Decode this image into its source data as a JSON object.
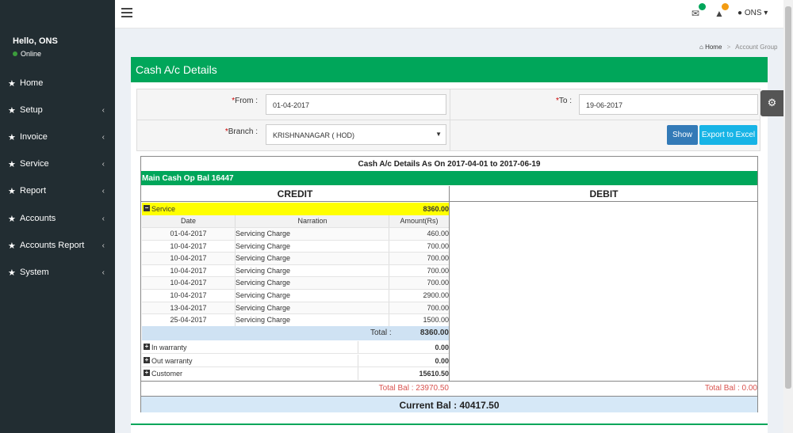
{
  "sidebar": {
    "greeting": "Hello, ONS",
    "status": "Online",
    "items": [
      {
        "label": "Home",
        "has_children": false
      },
      {
        "label": "Setup",
        "has_children": true
      },
      {
        "label": "Invoice",
        "has_children": true
      },
      {
        "label": "Service",
        "has_children": true
      },
      {
        "label": "Report",
        "has_children": true
      },
      {
        "label": "Accounts",
        "has_children": true
      },
      {
        "label": "Accounts Report",
        "has_children": true
      },
      {
        "label": "System",
        "has_children": true
      }
    ]
  },
  "topbar": {
    "user": "ONS",
    "icons": [
      "hamburger-icon",
      "mail-icon",
      "warning-icon",
      "user-icon"
    ],
    "badge_colors": [
      "#00a65a",
      "#f39c12"
    ]
  },
  "breadcrumb": {
    "home": "Home",
    "current": "Account Group"
  },
  "page": {
    "title": "Cash A/c Details"
  },
  "filters": {
    "from_label": "From :",
    "from_value": "01-04-2017",
    "to_label": "To :",
    "to_value": "19-06-2017",
    "branch_label": "Branch :",
    "branch_value": "KRISHNANAGAR ( HOD)",
    "show_label": "Show",
    "export_label": "Export to Excel"
  },
  "report": {
    "title": "Cash A/c Details As On 2017-04-01 to 2017-06-19",
    "opening_balance": "Main Cash Op Bal 16447",
    "credit_label": "CREDIT",
    "debit_label": "DEBIT",
    "service_group": {
      "name": "Service",
      "amount": "8360.00"
    },
    "detail_headers": {
      "date": "Date",
      "narration": "Narration",
      "amount": "Amount(Rs)"
    },
    "details": [
      {
        "date": "01-04-2017",
        "narration": "Servicing Charge",
        "amount": "460.00"
      },
      {
        "date": "10-04-2017",
        "narration": "Servicing Charge",
        "amount": "700.00"
      },
      {
        "date": "10-04-2017",
        "narration": "Servicing Charge",
        "amount": "700.00"
      },
      {
        "date": "10-04-2017",
        "narration": "Servicing Charge",
        "amount": "700.00"
      },
      {
        "date": "10-04-2017",
        "narration": "Servicing Charge",
        "amount": "700.00"
      },
      {
        "date": "10-04-2017",
        "narration": "Servicing Charge",
        "amount": "2900.00"
      },
      {
        "date": "13-04-2017",
        "narration": "Servicing Charge",
        "amount": "700.00"
      },
      {
        "date": "25-04-2017",
        "narration": "Servicing Charge",
        "amount": "1500.00"
      }
    ],
    "total_label": "Total :",
    "total_amount": "8360.00",
    "other_groups": [
      {
        "name": "In warranty",
        "amount": "0.00"
      },
      {
        "name": "Out warranty",
        "amount": "0.00"
      },
      {
        "name": "Customer",
        "amount": "15610.50"
      }
    ],
    "credit_total_bal": "Total Bal : 23970.50",
    "debit_total_bal": "Total Bal : 0.00",
    "current_bal": "Current Bal : 40417.50"
  },
  "colors": {
    "accent": "#00a65a",
    "sidebar": "#222d32",
    "highlight": "#ffff00",
    "button": "#337ab7",
    "export": "#17b4e6"
  }
}
